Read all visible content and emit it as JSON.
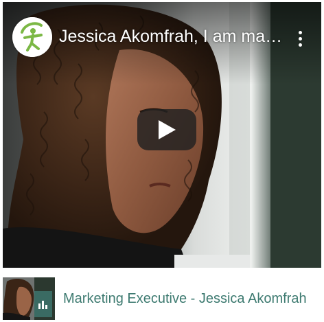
{
  "video": {
    "title": "Jessica Akomfrah, I am making...",
    "channel_logo_icon": "channel-logo-figure-icon",
    "more_icon": "more-vertical-icon",
    "play_icon": "play-icon",
    "play_button_color": "#212121"
  },
  "caption": {
    "label": "Marketing Executive - Jessica Akomfrah",
    "badge_icon": "bar-chart-icon",
    "text_color": "#3d7a70",
    "badge_color": "#3a6b63"
  }
}
